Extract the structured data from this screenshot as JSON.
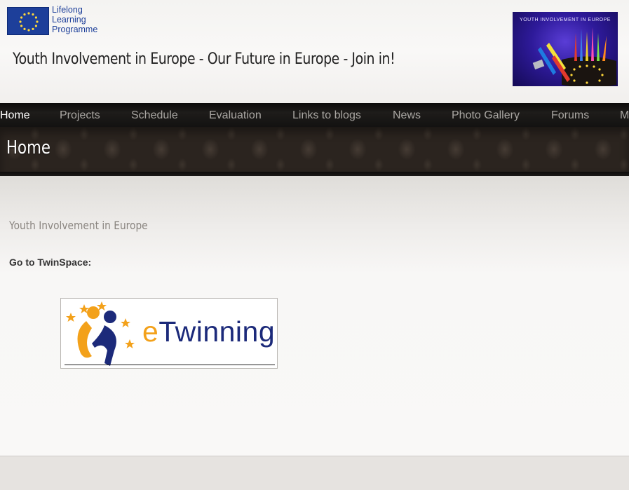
{
  "header": {
    "logo_lines": [
      "Lifelong",
      "Learning",
      "Programme"
    ],
    "site_title": "Youth Involvement in Europe - Our Future in Europe - Join in!",
    "image_caption": "YOUTH INVOLVEMENT IN EUROPE"
  },
  "nav": {
    "items": [
      {
        "label": "Home",
        "active": true
      },
      {
        "label": "Projects"
      },
      {
        "label": "Schedule"
      },
      {
        "label": "Evaluation"
      },
      {
        "label": "Links to blogs"
      },
      {
        "label": "News"
      },
      {
        "label": "Photo Gallery"
      },
      {
        "label": "Forums"
      },
      {
        "label": "M"
      }
    ]
  },
  "page": {
    "heading": "Home",
    "section_title": "Youth Involvement in Europe",
    "twinspace_label": "Go to TwinSpace:",
    "etwinning": {
      "prefix": "e",
      "rest": "Twinning"
    }
  },
  "colors": {
    "nav_bg": "#141312",
    "banner_bg": "#2b241f",
    "eu_blue": "#1d3f9a",
    "etwinning_navy": "#1c2a7a",
    "etwinning_orange": "#f3a11a"
  }
}
